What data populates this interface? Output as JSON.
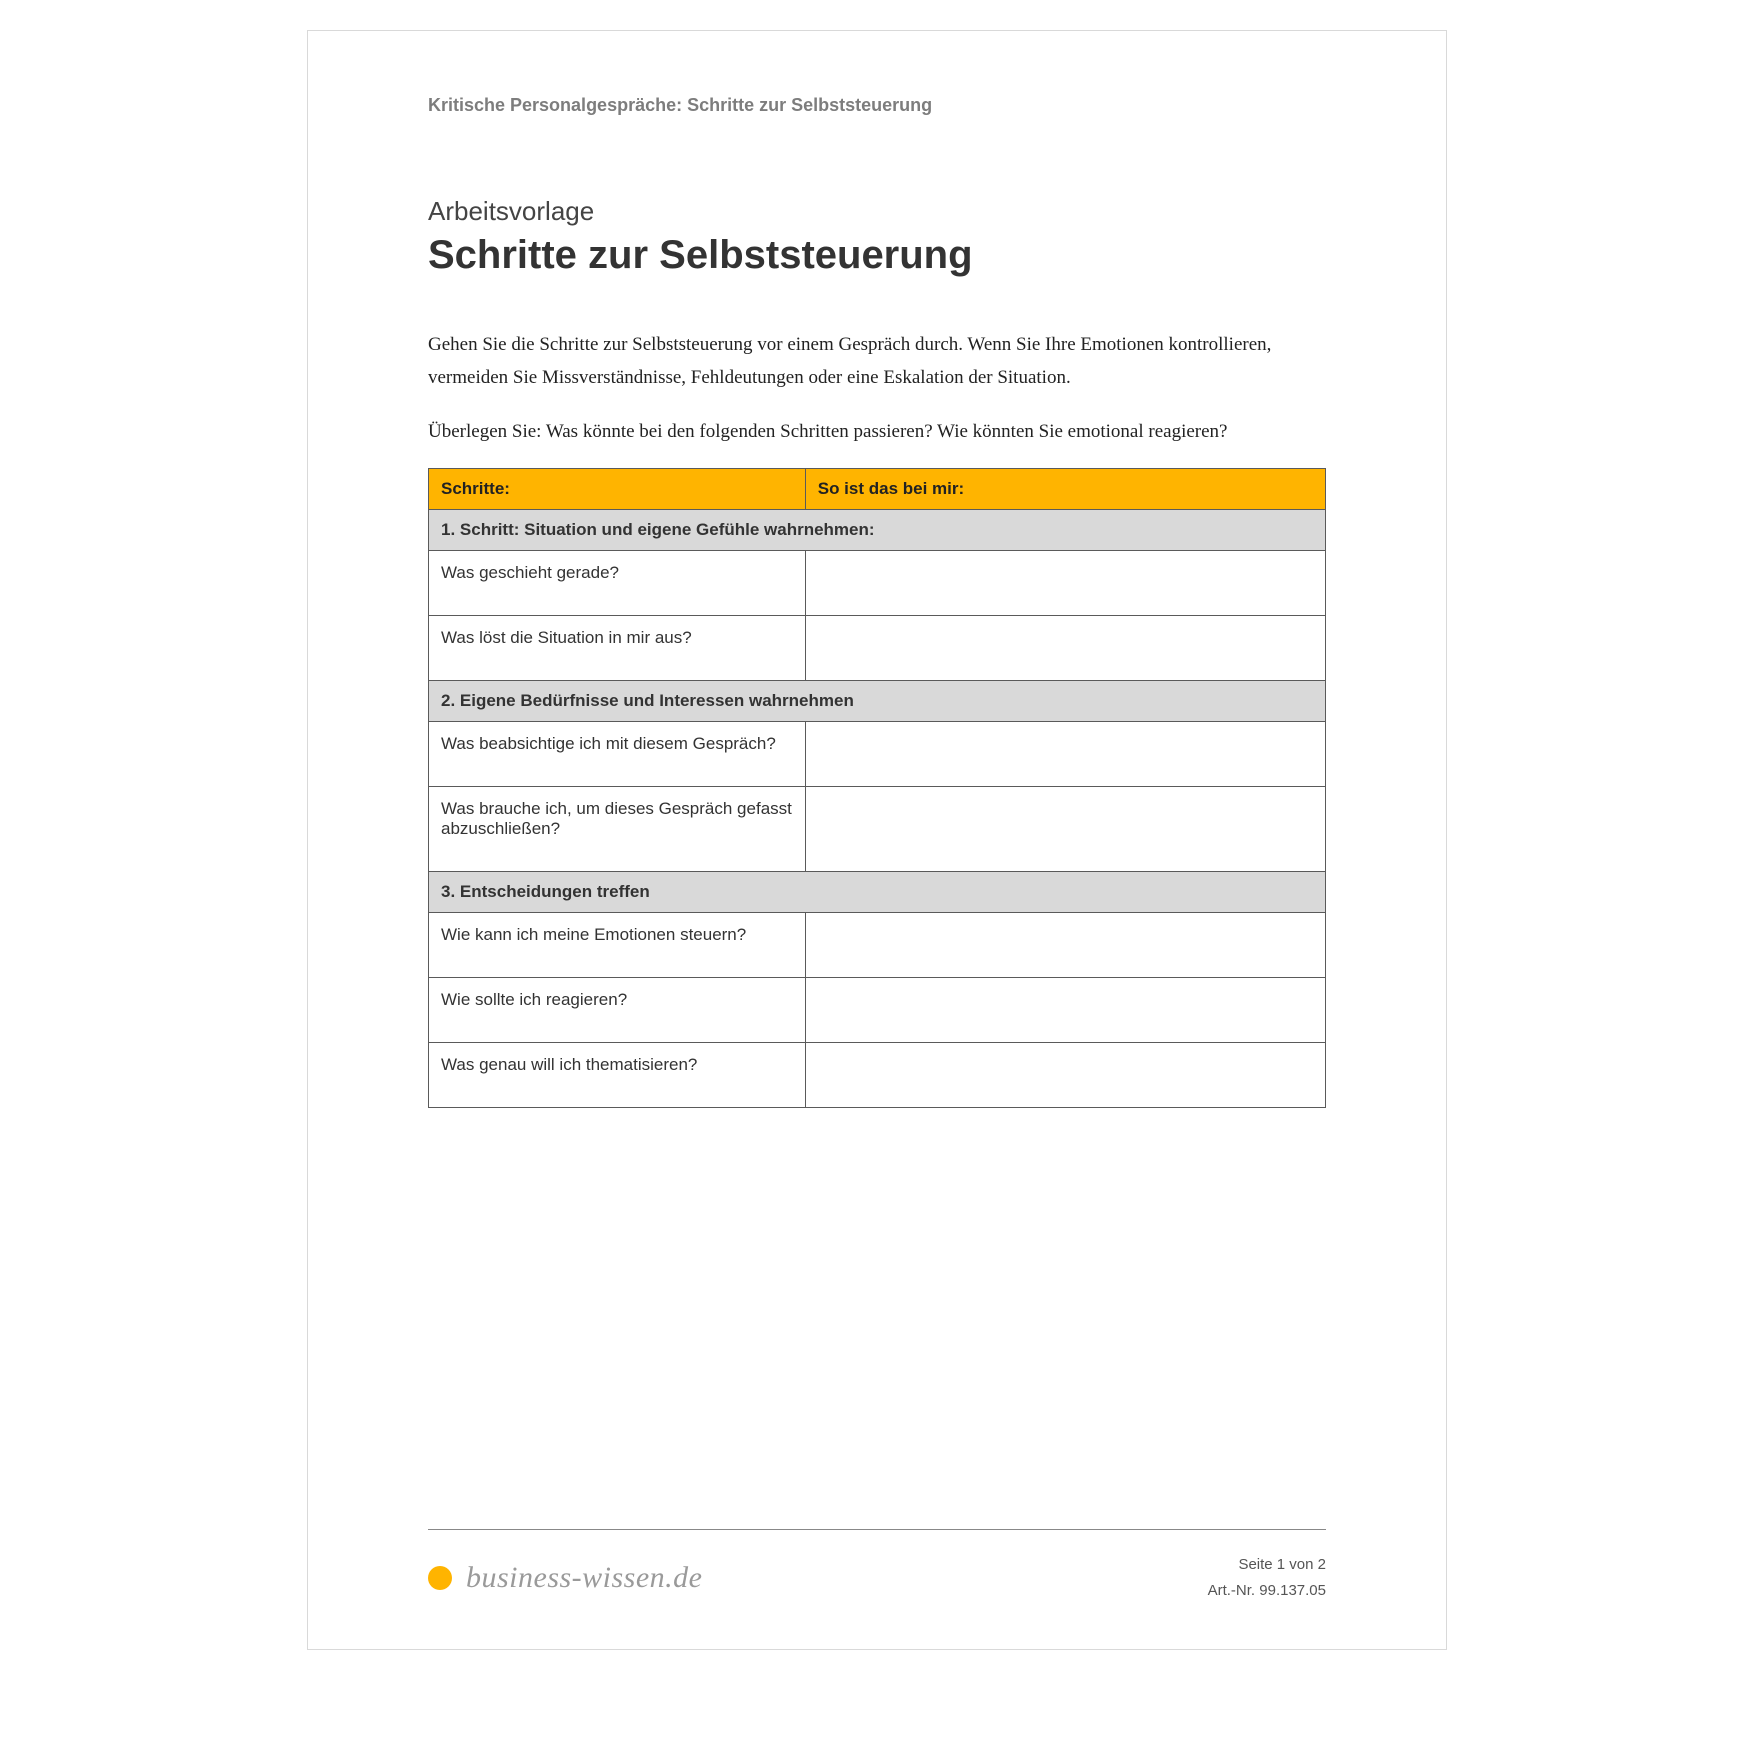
{
  "header": "Kritische Personalgespräche: Schritte zur Selbststeuerung",
  "subtitle": "Arbeitsvorlage",
  "title": "Schritte zur Selbststeuerung",
  "intro": {
    "p1": "Gehen Sie die Schritte zur Selbststeuerung vor einem Gespräch durch. Wenn Sie Ihre Emotionen kontrollieren, vermeiden Sie Missverständnisse, Fehldeutungen oder eine Eskalation der Situation.",
    "p2": "Überlegen Sie: Was könnte bei den folgenden Schritten passieren? Wie könnten Sie emotional reagieren?"
  },
  "table": {
    "col1": "Schritte:",
    "col2": "So ist das bei mir:",
    "sections": [
      {
        "heading": "1. Schritt: Situation und eigene Gefühle wahrnehmen:",
        "rows": [
          {
            "q": "Was geschieht gerade?",
            "a": ""
          },
          {
            "q": "Was löst die Situation in mir aus?",
            "a": ""
          }
        ]
      },
      {
        "heading": "2. Eigene Bedürfnisse und Interessen wahrnehmen",
        "rows": [
          {
            "q": "Was beabsichtige ich mit diesem Gespräch?",
            "a": ""
          },
          {
            "q": "Was brauche ich, um dieses Gespräch gefasst abzuschließen?",
            "a": ""
          }
        ]
      },
      {
        "heading": "3. Entscheidungen treffen",
        "rows": [
          {
            "q": "Wie kann ich meine Emotionen steuern?",
            "a": ""
          },
          {
            "q": "Wie sollte ich reagieren?",
            "a": ""
          },
          {
            "q": "Was genau will ich thematisieren?",
            "a": ""
          }
        ]
      }
    ]
  },
  "footer": {
    "brand": "business-wissen.de",
    "page": "Seite 1 von 2",
    "artnr": "Art.-Nr. 99.137.05"
  }
}
